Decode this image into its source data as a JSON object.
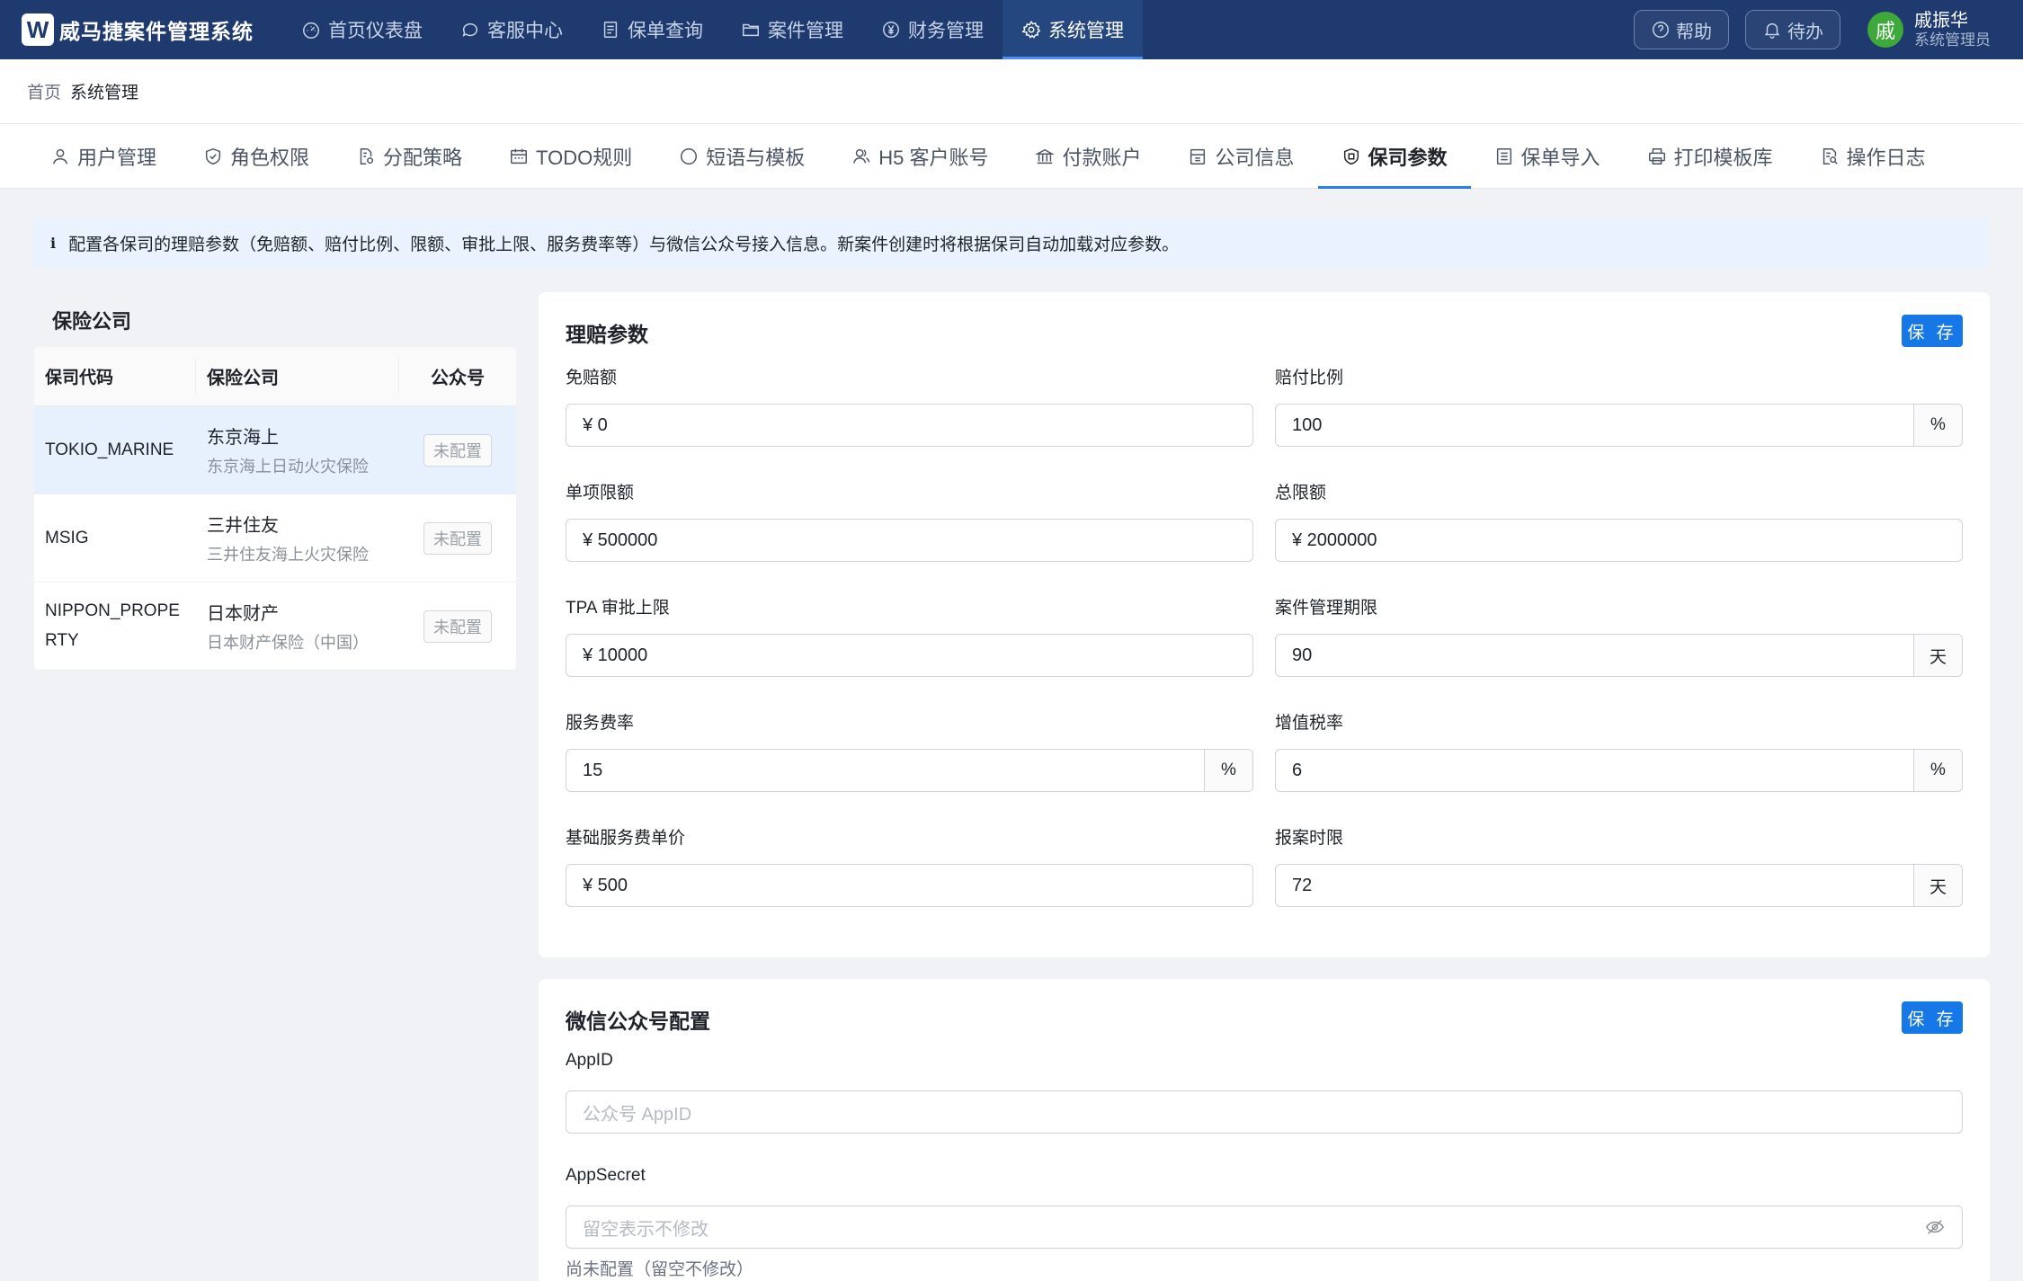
{
  "app": {
    "logo_letter": "W",
    "title": "威马捷案件管理系统"
  },
  "nav": [
    {
      "label": "首页仪表盘",
      "icon": "dashboard-icon"
    },
    {
      "label": "客服中心",
      "icon": "chat-icon"
    },
    {
      "label": "保单查询",
      "icon": "document-list-icon"
    },
    {
      "label": "案件管理",
      "icon": "folder-icon"
    },
    {
      "label": "财务管理",
      "icon": "yen-icon"
    },
    {
      "label": "系统管理",
      "icon": "gear-icon",
      "active": true
    }
  ],
  "top_right": {
    "help_label": "帮助",
    "todo_label": "待办",
    "avatar_char": "戚",
    "user_name": "戚振华",
    "user_role": "系统管理员",
    "avatar_color": "#3ea83a"
  },
  "breadcrumb": {
    "home": "首页",
    "current": "系统管理"
  },
  "subtabs": [
    {
      "label": "用户管理",
      "icon": "user-icon"
    },
    {
      "label": "角色权限",
      "icon": "shield-check-icon"
    },
    {
      "label": "分配策略",
      "icon": "file-settings-icon"
    },
    {
      "label": "TODO规则",
      "icon": "calendar-icon"
    },
    {
      "label": "短语与模板",
      "icon": "message-dots-icon"
    },
    {
      "label": "H5 客户账号",
      "icon": "users-icon"
    },
    {
      "label": "付款账户",
      "icon": "bank-icon"
    },
    {
      "label": "公司信息",
      "icon": "building-icon"
    },
    {
      "label": "保司参数",
      "icon": "insurance-shield-icon",
      "active": true
    },
    {
      "label": "保单导入",
      "icon": "import-list-icon"
    },
    {
      "label": "打印模板库",
      "icon": "printer-icon"
    },
    {
      "label": "操作日志",
      "icon": "log-search-icon"
    }
  ],
  "info_text": "配置各保司的理赔参数（免赔额、赔付比例、限额、审批上限、服务费率等）与微信公众号接入信息。新案件创建时将根据保司自动加载对应参数。",
  "left_panel": {
    "title": "保险公司",
    "columns": [
      "保司代码",
      "保险公司",
      "公众号"
    ],
    "rows": [
      {
        "code": "TOKIO_MARINE",
        "name": "东京海上",
        "full_name": "东京海上日动火灾保险",
        "status": "未配置",
        "selected": true
      },
      {
        "code": "MSIG",
        "name": "三井住友",
        "full_name": "三井住友海上火灾保险",
        "status": "未配置"
      },
      {
        "code": "NIPPON_PROPERTY",
        "code_line1": "NIPPON_PROPE",
        "code_line2": "RTY",
        "name": "日本财产",
        "full_name": "日本财产保险（中国）",
        "status": "未配置"
      }
    ]
  },
  "claims": {
    "title": "理赔参数",
    "save_label": "保 存",
    "fields": {
      "deductible": {
        "label": "免赔额",
        "value": "¥ 0"
      },
      "payout_ratio": {
        "label": "赔付比例",
        "value": "100",
        "suffix": "%"
      },
      "single_limit": {
        "label": "单项限额",
        "value": "¥ 500000"
      },
      "total_limit": {
        "label": "总限额",
        "value": "¥ 2000000"
      },
      "tpa_limit": {
        "label": "TPA 审批上限",
        "value": "¥ 10000"
      },
      "case_period": {
        "label": "案件管理期限",
        "value": "90",
        "suffix": "天"
      },
      "service_rate": {
        "label": "服务费率",
        "value": "15",
        "suffix": "%"
      },
      "vat_rate": {
        "label": "增值税率",
        "value": "6",
        "suffix": "%"
      },
      "base_fee": {
        "label": "基础服务费单价",
        "value": "¥ 500"
      },
      "report_limit": {
        "label": "报案时限",
        "value": "72",
        "suffix": "天"
      }
    }
  },
  "wechat": {
    "title": "微信公众号配置",
    "save_label": "保 存",
    "appid": {
      "label": "AppID",
      "placeholder": "公众号 AppID"
    },
    "appsecret": {
      "label": "AppSecret",
      "placeholder": "留空表示不修改",
      "hint": "尚未配置（留空不修改）"
    }
  }
}
